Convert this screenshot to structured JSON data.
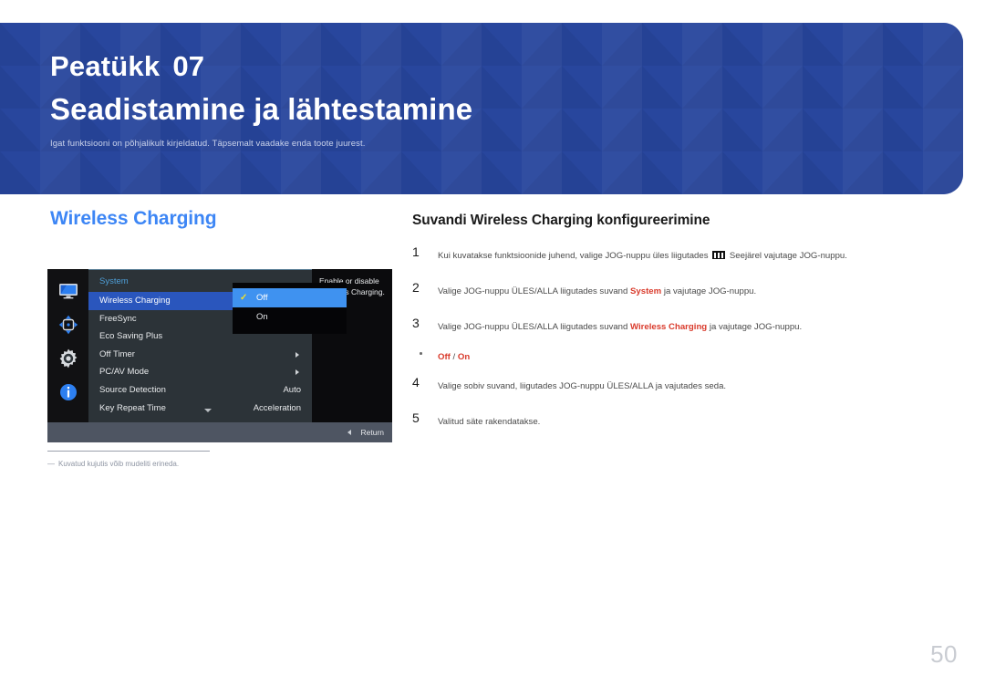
{
  "banner": {
    "chapter_label": "Peatükk",
    "chapter_number": "07",
    "title": "Seadistamine ja lähtestamine",
    "subtitle": "Igat funktsiooni on põhjalikult kirjeldatud. Täpsemalt vaadake enda toote juurest.",
    "bg_color": "#21409a"
  },
  "left": {
    "section_title": "Wireless Charging",
    "section_title_color": "#3d86f5",
    "footnote_dash": "―",
    "footnote": "Kuvatud kujutis võib mudeliti erineda."
  },
  "osd": {
    "menu_title": "System",
    "icons": [
      "monitor-icon",
      "move-arrows-icon",
      "gear-icon",
      "info-icon"
    ],
    "rows": [
      {
        "label": "Wireless Charging",
        "value": "",
        "arrow": false,
        "selected": true
      },
      {
        "label": "FreeSync",
        "value": "",
        "arrow": false,
        "selected": false
      },
      {
        "label": "Eco Saving Plus",
        "value": "",
        "arrow": false,
        "selected": false
      },
      {
        "label": "Off Timer",
        "value": "",
        "arrow": true,
        "selected": false
      },
      {
        "label": "PC/AV Mode",
        "value": "",
        "arrow": true,
        "selected": false
      },
      {
        "label": "Source Detection",
        "value": "Auto",
        "arrow": false,
        "selected": false
      },
      {
        "label": "Key Repeat Time",
        "value": "Acceleration",
        "arrow": false,
        "selected": false
      }
    ],
    "dropdown": {
      "options": [
        "Off",
        "On"
      ],
      "selected": "Off",
      "check_glyph": "✓",
      "highlight_color": "#3f92f0"
    },
    "description": "Enable or disable Wireless Charging.",
    "return_label": "Return"
  },
  "right": {
    "title": "Suvandi Wireless Charging konfigureerimine",
    "steps": [
      {
        "number": "1",
        "parts": [
          {
            "t": "Kui kuvatakse funktsioonide juhend, valige JOG-nuppu üles liigutades ",
            "hl": false
          },
          {
            "t": "__MENU_ICON__",
            "hl": false
          },
          {
            "t": " Seejärel vajutage JOG-nuppu.",
            "hl": false
          }
        ]
      },
      {
        "number": "2",
        "parts": [
          {
            "t": "Valige JOG-nuppu ÜLES/ALLA liigutades suvand ",
            "hl": false
          },
          {
            "t": "System",
            "hl": true
          },
          {
            "t": " ja vajutage JOG-nuppu.",
            "hl": false
          }
        ]
      },
      {
        "number": "3",
        "parts": [
          {
            "t": "Valige JOG-nuppu ÜLES/ALLA liigutades suvand ",
            "hl": false
          },
          {
            "t": "Wireless Charging",
            "hl": true
          },
          {
            "t": " ja vajutage JOG-nuppu.",
            "hl": false
          }
        ]
      }
    ],
    "bullet": {
      "option_a": "Off",
      "separator": " / ",
      "option_b": "On"
    },
    "steps_after": [
      {
        "number": "4",
        "parts": [
          {
            "t": "Valige sobiv suvand, liigutades JOG-nuppu ÜLES/ALLA ja vajutades seda.",
            "hl": false
          }
        ]
      },
      {
        "number": "5",
        "parts": [
          {
            "t": "Valitud säte rakendatakse.",
            "hl": false
          }
        ]
      }
    ],
    "highlight_color": "#d93a2b"
  },
  "page_number": "50"
}
